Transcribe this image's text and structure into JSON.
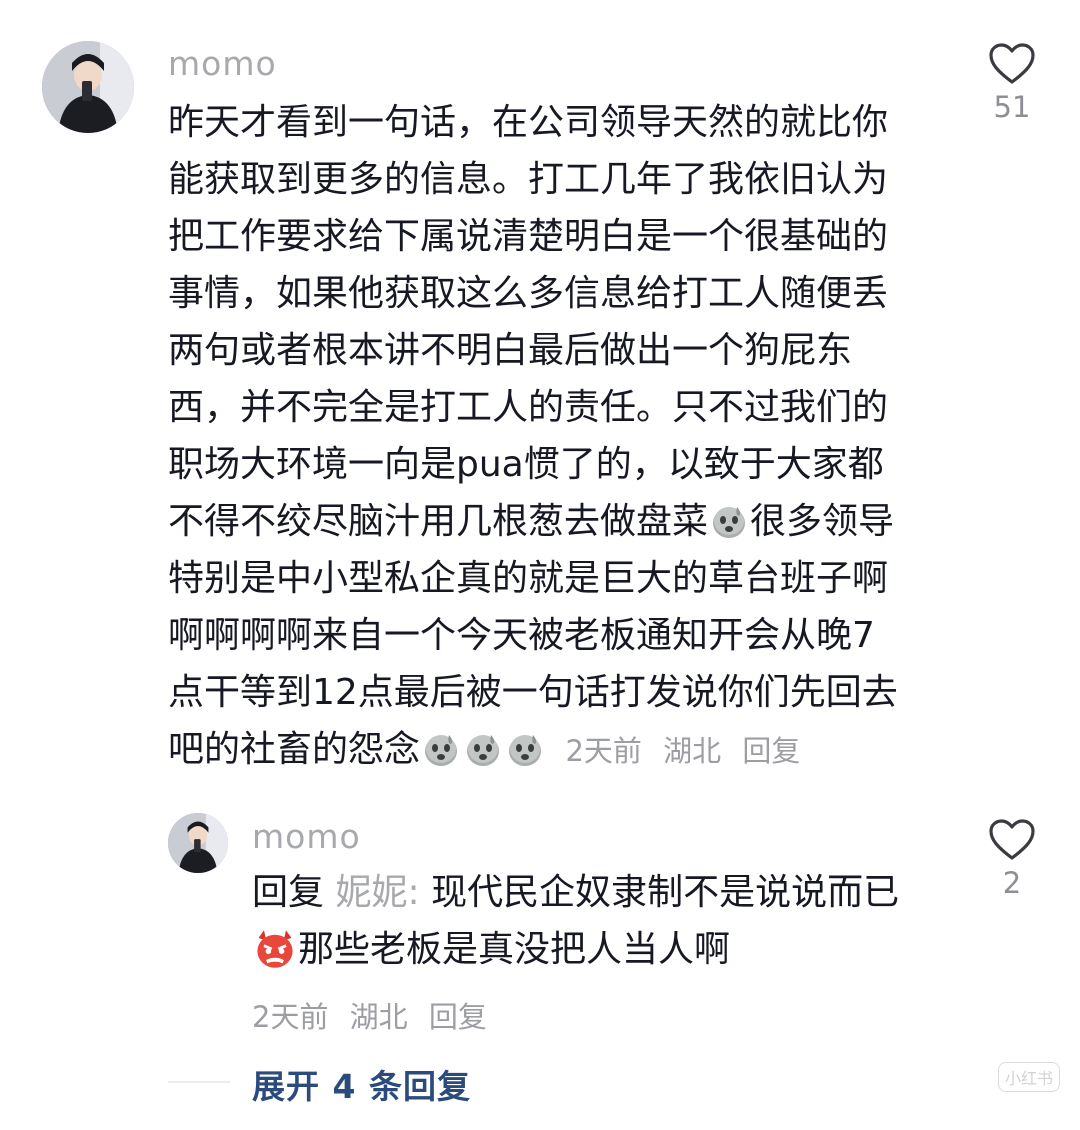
{
  "comment": {
    "username": "momo",
    "lines": [
      "昨天才看到一句话，在公司领导天然的就比你",
      "能获取到更多的信息。打工几年了我依旧认为",
      "把工作要求给下属说清楚明白是一个很基础的",
      "事情，如果他获取这么多信息给打工人随便丢",
      "两句或者根本讲不明白最后做出一个狗屁东",
      "西，并不完全是打工人的责任。只不过我们的",
      "职场大环境一向是pua惯了的，以致于大家都"
    ],
    "line8_a": "不得不绞尽脑汁用几根葱去做盘菜",
    "line8_b": "很多领导",
    "line9": "特别是中小型私企真的就是巨大的草台班子啊",
    "line10": "啊啊啊啊来自一个今天被老板通知开会从晚7",
    "line11": "点干等到12点最后被一句话打发说你们先回去",
    "line12": "吧的社畜的怨念",
    "time": "2天前",
    "location": "湖北",
    "reply_label": "回复",
    "likes": "51",
    "emoji_name": "sweat-face-emoji"
  },
  "reply": {
    "username": "momo",
    "prefix": "回复",
    "target": "妮妮",
    "colon": ":",
    "text_1": "现代民企奴隶制不是说说而已",
    "text_2": "那些老板是真没把人当人啊",
    "time": "2天前",
    "location": "湖北",
    "reply_label": "回复",
    "likes": "2",
    "emoji_name": "angry-devil-emoji"
  },
  "expand": {
    "label": "展开 4 条回复"
  },
  "watermark": {
    "text": "小红书"
  },
  "colors": {
    "accent": "#2b4b7d",
    "meta": "#9d9ea3",
    "text": "#161823"
  }
}
